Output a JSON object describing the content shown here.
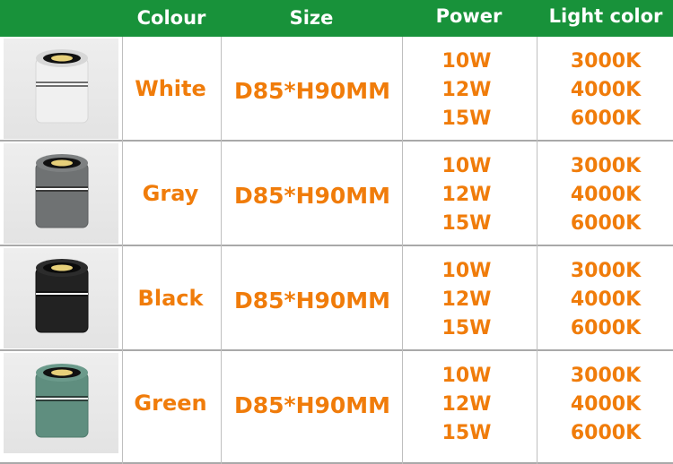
{
  "header": {
    "colour": "Colour",
    "size": "Size",
    "power": "Power",
    "light_color": "Light color",
    "bg_color": "#18923a"
  },
  "text_color": "#f07c0a",
  "rows": [
    {
      "colour": "White",
      "size": "D85*H90MM",
      "power": [
        "10W",
        "12W",
        "15W"
      ],
      "light": [
        "3000K",
        "4000K",
        "6000K"
      ],
      "lamp_body_color": "#efefef",
      "image_icon": "white-cylinder-downlight"
    },
    {
      "colour": "Gray",
      "size": "D85*H90MM",
      "power": [
        "10W",
        "12W",
        "15W"
      ],
      "light": [
        "3000K",
        "4000K",
        "6000K"
      ],
      "lamp_body_color": "#6f7273",
      "image_icon": "gray-cylinder-downlight"
    },
    {
      "colour": "Black",
      "size": "D85*H90MM",
      "power": [
        "10W",
        "12W",
        "15W"
      ],
      "light": [
        "3000K",
        "4000K",
        "6000K"
      ],
      "lamp_body_color": "#222222",
      "image_icon": "black-cylinder-downlight"
    },
    {
      "colour": "Green",
      "size": "D85*H90MM",
      "power": [
        "10W",
        "12W",
        "15W"
      ],
      "light": [
        "3000K",
        "4000K",
        "6000K"
      ],
      "lamp_body_color": "#5f8e7f",
      "image_icon": "green-cylinder-downlight"
    }
  ]
}
